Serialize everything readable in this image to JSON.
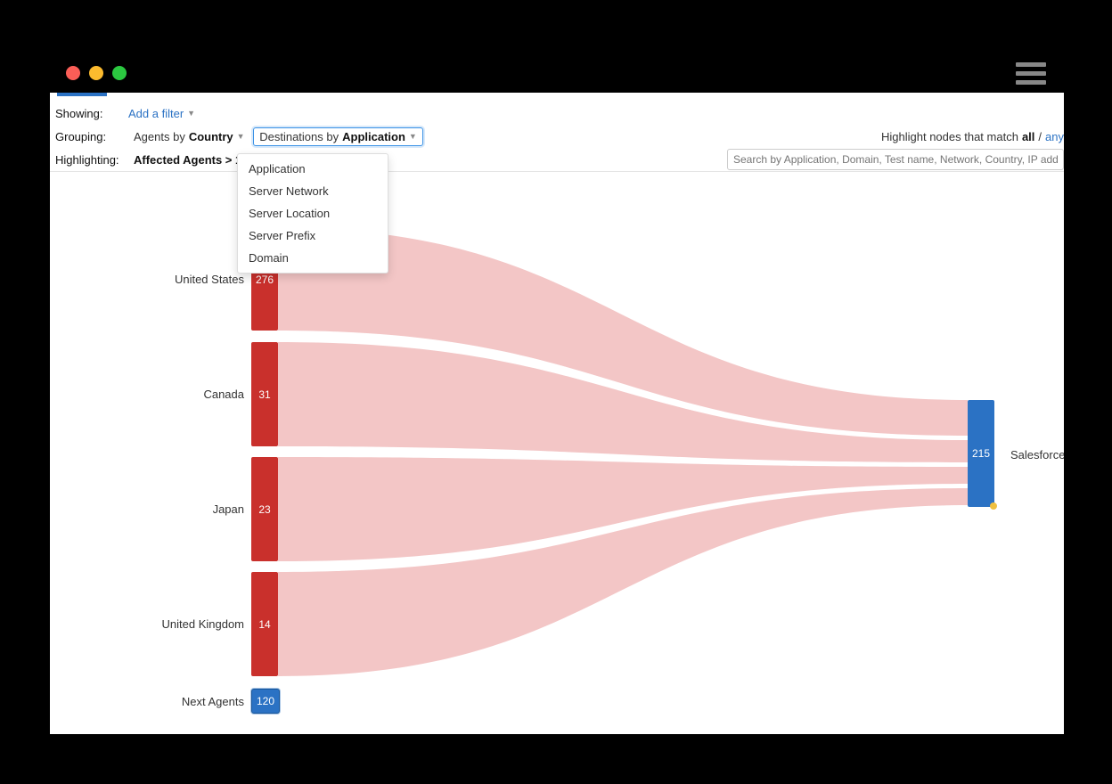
{
  "window": {
    "traffic_lights": [
      "close",
      "minimize",
      "zoom"
    ]
  },
  "controls": {
    "showing_label": "Showing:",
    "add_filter": "Add a filter",
    "grouping_label": "Grouping:",
    "agents_by_prefix": "Agents by ",
    "agents_by_value": "Country",
    "destinations_by_prefix": "Destinations by ",
    "destinations_by_value": "Application",
    "highlighting_label": "Highlighting:",
    "highlighting_value": "Affected Agents > 10%",
    "match_prefix": "Highlight nodes that match ",
    "match_all": "all",
    "match_sep": " / ",
    "match_any": "any",
    "search_placeholder": "Search by Application, Domain, Test name, Network, Country, IP address,"
  },
  "dropdown_menu": {
    "items": [
      "Application",
      "Server Network",
      "Server Location",
      "Server Prefix",
      "Domain"
    ]
  },
  "chart_data": {
    "type": "sankey",
    "sources": [
      {
        "label": "United States",
        "value": 276
      },
      {
        "label": "Canada",
        "value": 31
      },
      {
        "label": "Japan",
        "value": 23
      },
      {
        "label": "United Kingdom",
        "value": 14
      }
    ],
    "next_agents": {
      "label": "Next Agents",
      "value": 120
    },
    "destination": {
      "label": "Salesforce",
      "value": 215
    },
    "colors": {
      "source_bar": "#c9302c",
      "flow": "#f3c6c6",
      "dest_bar": "#2b72c4",
      "next_bar": "#2b72c4"
    }
  }
}
